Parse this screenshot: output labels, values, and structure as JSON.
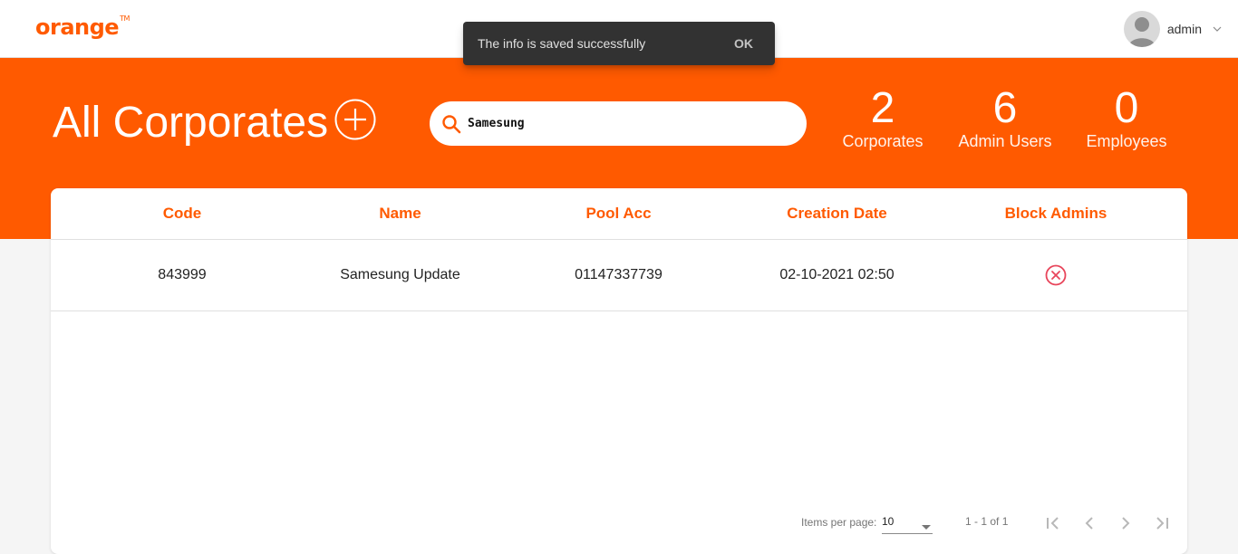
{
  "app": {
    "brand": "orange",
    "brand_tm": "TM"
  },
  "user": {
    "name": "admin"
  },
  "snackbar": {
    "message": "The info is saved successfully",
    "action": "OK"
  },
  "page": {
    "title": "All Corporates"
  },
  "search": {
    "value": "Samesung",
    "placeholder": ""
  },
  "stats": [
    {
      "value": "2",
      "label": "Corporates"
    },
    {
      "value": "6",
      "label": "Admin Users"
    },
    {
      "value": "0",
      "label": "Employees"
    }
  ],
  "table": {
    "columns": [
      "Code",
      "Name",
      "Pool Acc",
      "Creation Date",
      "Block Admins"
    ],
    "rows": [
      {
        "code": "843999",
        "name": "Samesung Update",
        "pool_acc": "01147337739",
        "creation_date": "02-10-2021 02:50",
        "block_admins_icon": "cancel-circle-icon"
      }
    ]
  },
  "paginator": {
    "items_per_page_label": "Items per page:",
    "page_size": "10",
    "range_label": "1 - 1 of 1"
  },
  "colors": {
    "brand": "#ff5a00",
    "block_icon": "#e8455b",
    "snackbar_bg": "#323232"
  },
  "icons": {
    "search": "search-icon",
    "add": "add-circle-icon",
    "avatar": "person-icon",
    "user_menu": "chevron-down-icon"
  }
}
